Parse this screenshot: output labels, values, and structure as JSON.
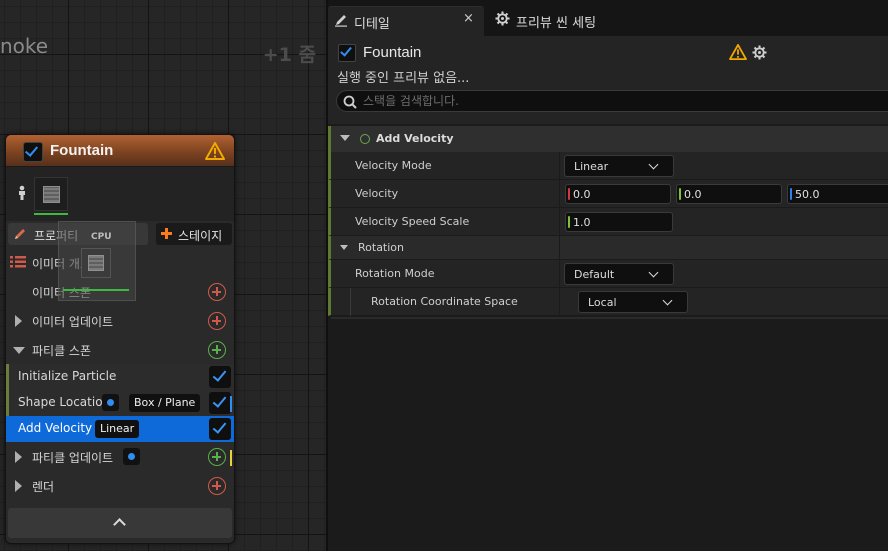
{
  "graph": {
    "title_partial": "noke",
    "zoom_label": "+1 줌"
  },
  "emitter_node": {
    "title": "Fountain",
    "enabled": true,
    "tab_properties": "프로퍼티",
    "tab_stage": "스테이지",
    "overlay_label": "CPU",
    "rows": {
      "emitter_summary": "이미터 개요",
      "emitter_spawn": "이미터 스폰",
      "emitter_update": "이미터 업데이트",
      "particle_spawn": "파티클 스폰",
      "particle_update": "파티클 업데이트",
      "render": "렌더"
    },
    "modules": [
      {
        "label": "Initialize Particle",
        "checked": true
      },
      {
        "label": "Shape Location",
        "value": "Box / Plane",
        "checked": true
      },
      {
        "label": "Add Velocity",
        "value": "Linear",
        "checked": true,
        "selected": true
      }
    ]
  },
  "details_panel": {
    "tab_details": "디테일",
    "tab_close": "×",
    "tab_preview": "프리뷰 씬 세팅",
    "title": "Fountain",
    "subtitle": "실행 중인 프리뷰 없음...",
    "search_placeholder": "스택을 검색합니다.",
    "section": "Add Velocity",
    "properties": {
      "velocity_mode": {
        "name": "Velocity Mode",
        "value": "Linear"
      },
      "velocity": {
        "name": "Velocity",
        "x": "0.0",
        "y": "0.0",
        "z": "50.0"
      },
      "velocity_speed_scale": {
        "name": "Velocity Speed Scale",
        "value": "1.0"
      }
    },
    "rotation": {
      "category": "Rotation",
      "mode": {
        "name": "Rotation Mode",
        "value": "Default"
      },
      "coordinate_space": {
        "name": "Rotation Coordinate Space",
        "value": "Local"
      }
    }
  },
  "colors": {
    "accent_blue": "#0e6ad8",
    "warning": "#f2a900",
    "axis_x": "#d23b3b",
    "axis_y": "#7ec23a",
    "axis_z": "#2f7ff0"
  }
}
